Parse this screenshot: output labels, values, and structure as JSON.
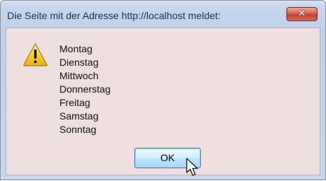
{
  "dialog": {
    "title": "Die Seite mit der Adresse http://localhost meldet:",
    "close_icon": "close-icon",
    "icon": "warning-icon",
    "message_lines": [
      "Montag",
      "Dienstag",
      "Mittwoch",
      "Donnerstag",
      "Freitag",
      "Samstag",
      "Sonntag"
    ],
    "ok_label": "OK"
  },
  "cursor": {
    "icon": "mouse-pointer-icon"
  },
  "colors": {
    "close_button": "#c9503a",
    "warning": "#f3cc2e",
    "ok_button": "#bee6fd"
  }
}
